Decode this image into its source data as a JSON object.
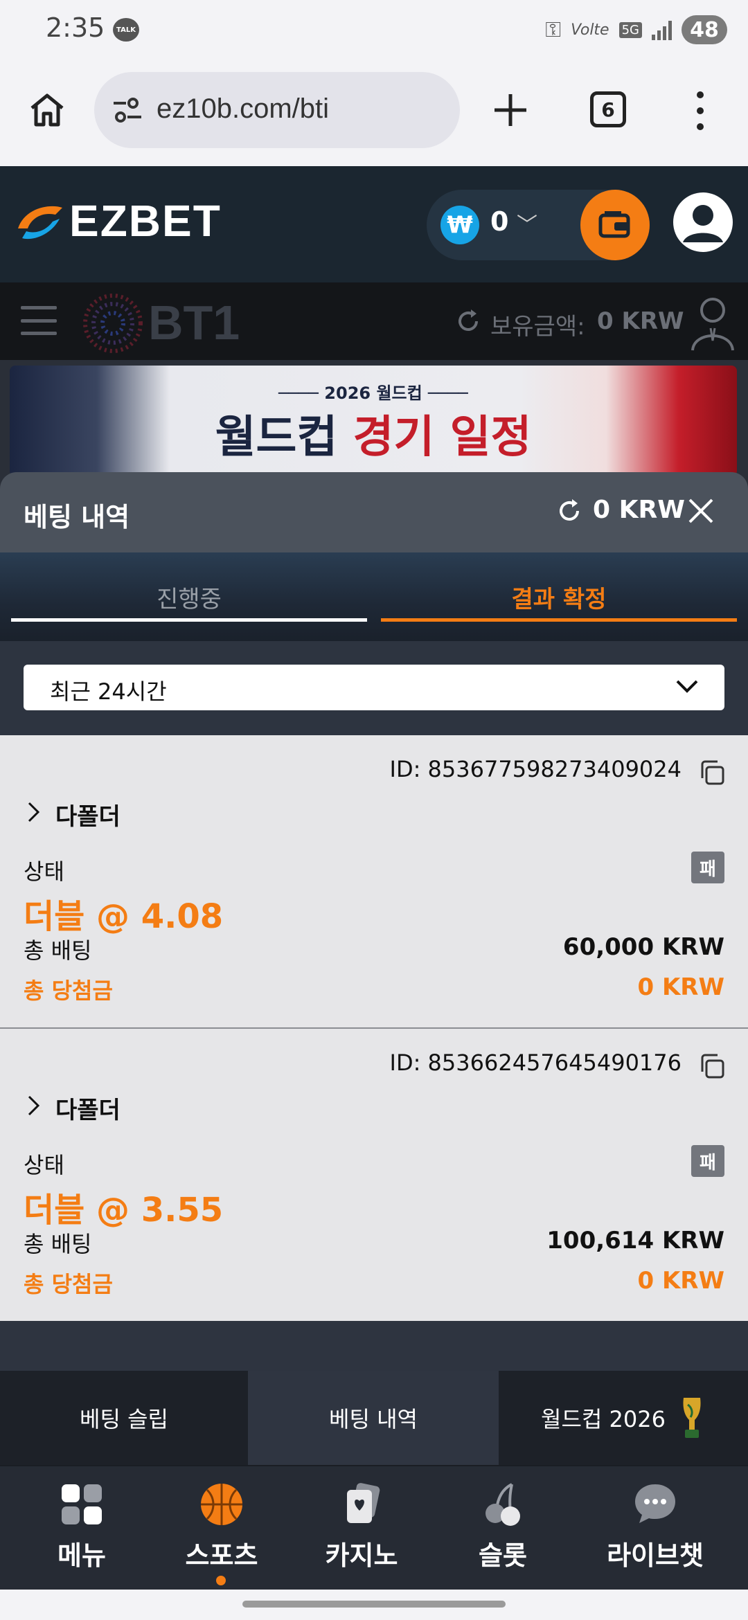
{
  "status_bar": {
    "time": "2:35",
    "talk_badge": "TALK",
    "network": "5G",
    "volte": "Volte",
    "battery": "48"
  },
  "browser": {
    "url": "ez10b.com/bti",
    "tab_count": "6"
  },
  "header": {
    "logo": "EZBET",
    "balance": "0",
    "currency_symbol": "₩"
  },
  "bt1_bar": {
    "logo": "BT1",
    "hold_label": "보유금액:",
    "hold_value": "0 KRW"
  },
  "banner": {
    "year_text": "2026 월드컵",
    "title_main": "월드컵",
    "title_accent": "경기 일정"
  },
  "bet_history": {
    "title": "베팅 내역",
    "balance": "0 KRW",
    "tabs": [
      {
        "label": "진행중",
        "active": false
      },
      {
        "label": "결과 확정",
        "active": true
      }
    ],
    "filter": {
      "selected": "최근 24시간"
    },
    "bets": [
      {
        "id": "ID: 853677598273409024",
        "type": "다폴더",
        "status_label": "상태",
        "result": "패",
        "odds": "더블 @ 4.08",
        "stake_label": "총 배팅",
        "stake": "60,000 KRW",
        "win_label": "총 당첨금",
        "win": "0 KRW"
      },
      {
        "id": "ID: 853662457645490176",
        "type": "다폴더",
        "status_label": "상태",
        "result": "패",
        "odds": "더블 @ 3.55",
        "stake_label": "총 배팅",
        "stake": "100,614 KRW",
        "win_label": "총 당첨금",
        "win": "0 KRW"
      }
    ]
  },
  "sub_tabs": {
    "slip": "베팅 슬립",
    "history": "베팅 내역",
    "worldcup": "월드컵 2026"
  },
  "bottom_nav": [
    {
      "label": "메뉴",
      "icon": "grid-icon"
    },
    {
      "label": "스포츠",
      "icon": "basketball-icon",
      "active": true
    },
    {
      "label": "카지노",
      "icon": "cards-icon"
    },
    {
      "label": "슬롯",
      "icon": "cherry-icon"
    },
    {
      "label": "라이브챗",
      "icon": "chat-icon"
    }
  ],
  "colors": {
    "accent": "#f47d14",
    "header_bg": "#1b2630",
    "panel_bg": "#4b525c",
    "card_bg": "#e6e6e8"
  }
}
